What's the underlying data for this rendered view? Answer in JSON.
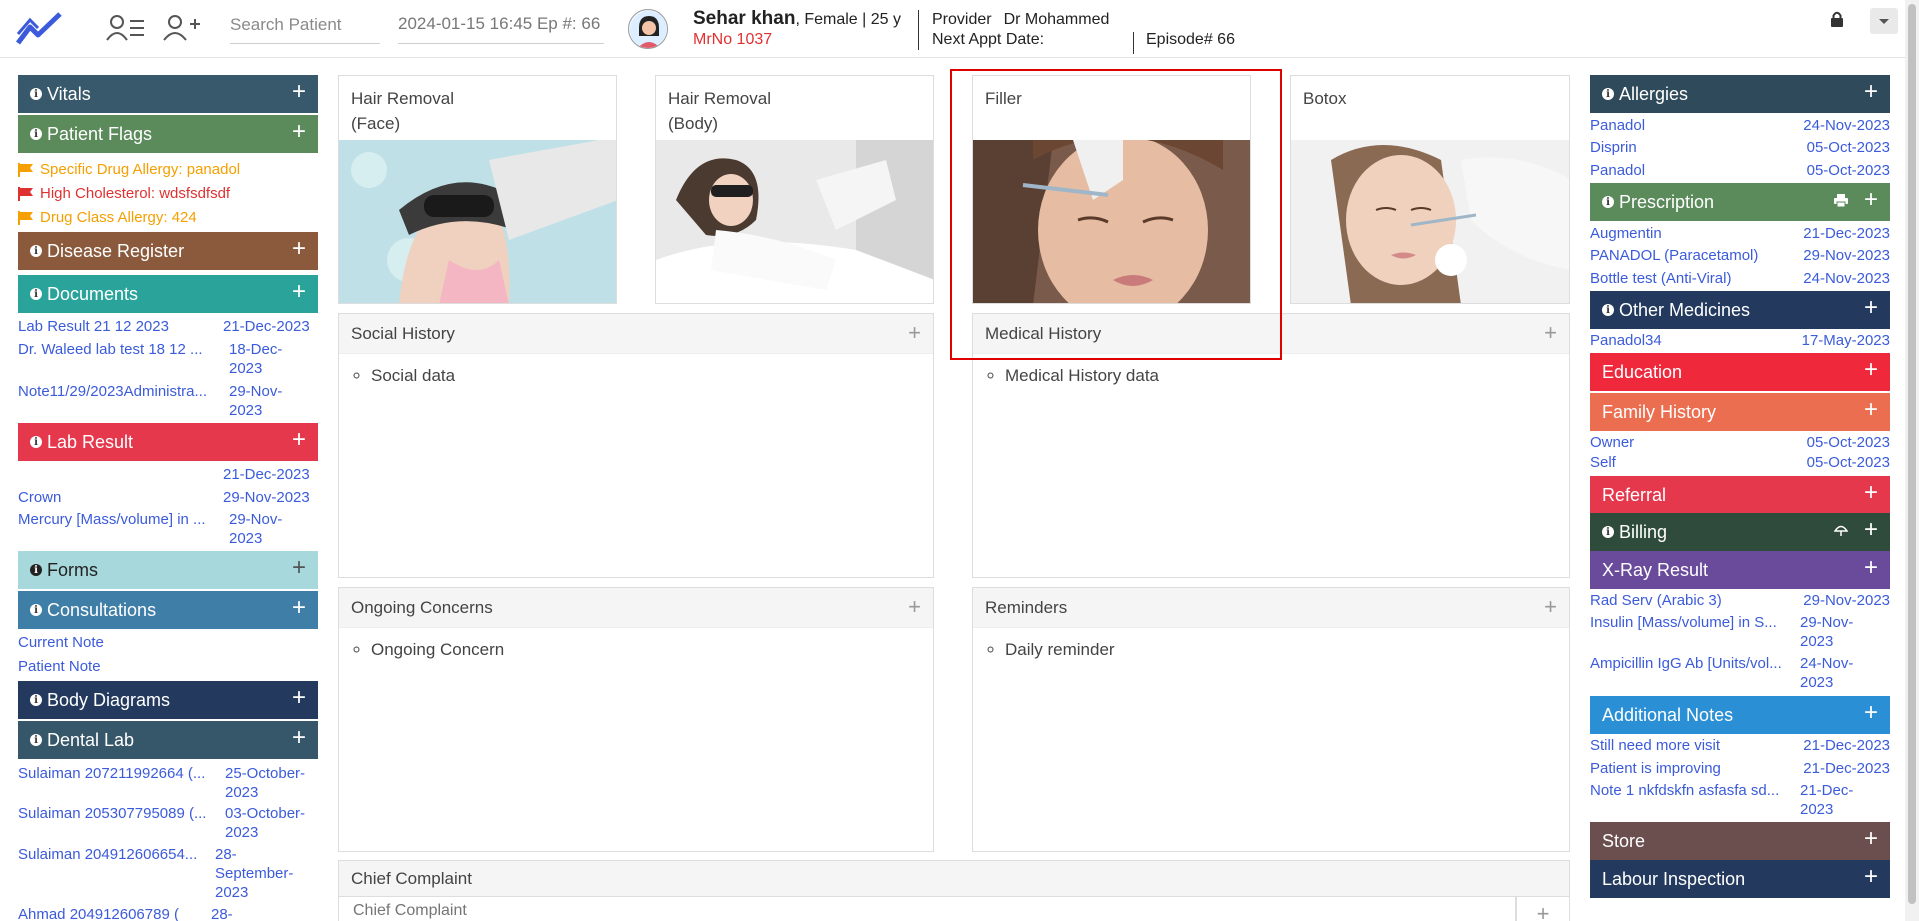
{
  "header": {
    "search_placeholder": "Search Patient",
    "episode_select": "2024-01-15 16:45 Ep #: 66",
    "patient_name": "Sehar khan",
    "patient_meta": ", Female | 25 y",
    "mrn": "MrNo 1037",
    "provider_label": "Provider",
    "provider_value": "Dr Mohammed",
    "next_appt_label": "Next Appt Date:",
    "episode_label": "Episode# 66"
  },
  "left": {
    "vitals": "Vitals",
    "patient_flags": "Patient Flags",
    "flags": [
      {
        "text": "Specific Drug Allergy: panadol",
        "color": "#f59f00"
      },
      {
        "text": "High Cholesterol: wdsfsdfsdf",
        "color": "#e03131"
      },
      {
        "text": "Drug Class Allergy: 424",
        "color": "#f59f00"
      }
    ],
    "disease_register": "Disease Register",
    "documents": "Documents",
    "documents_rows": [
      {
        "name": "Lab Result 21 12 2023",
        "date": "21-Dec-2023"
      },
      {
        "name": "Dr. Waleed lab test 18 12 ...",
        "date1": "18-Dec-",
        "date2": "2023"
      },
      {
        "name": "Note11/29/2023Administra...",
        "date1": "29-Nov-",
        "date2": "2023"
      }
    ],
    "lab_result": "Lab Result",
    "lab_rows": [
      {
        "name": "",
        "date": "21-Dec-2023"
      },
      {
        "name": "Crown",
        "date": "29-Nov-2023"
      },
      {
        "name": "Mercury [Mass/volume] in ...",
        "date1": "29-Nov-",
        "date2": "2023"
      }
    ],
    "forms": "Forms",
    "consultations": "Consultations",
    "consult_rows": [
      "Current Note",
      "Patient Note"
    ],
    "body_diagrams": "Body Diagrams",
    "dental_lab": "Dental Lab",
    "dental_rows": [
      {
        "name": "Sulaiman 207211992664 (...",
        "date1": "25-October-",
        "date2": "2023"
      },
      {
        "name": "Sulaiman 205307795089 (...",
        "date1": "03-October-",
        "date2": "2023"
      },
      {
        "name": "Sulaiman 204912606654...",
        "date1": "28-",
        "date2": "September-",
        "date3": "2023"
      },
      {
        "name": "Ahmad 204912606789 (",
        "date1": "28-"
      }
    ]
  },
  "center": {
    "cards": [
      {
        "title1": "Hair Removal",
        "title2": "(Face)"
      },
      {
        "title1": "Hair Removal",
        "title2": "(Body)"
      },
      {
        "title1": "Filler",
        "title2": ""
      },
      {
        "title1": "Botox",
        "title2": ""
      }
    ],
    "social_history": {
      "title": "Social History",
      "item": "Social data"
    },
    "medical_history": {
      "title": "Medical History",
      "item": "Medical History data"
    },
    "ongoing_concerns": {
      "title": "Ongoing Concerns",
      "item": "Ongoing Concern"
    },
    "reminders": {
      "title": "Reminders",
      "item": "Daily reminder"
    },
    "chief_complaint": {
      "title": "Chief Complaint",
      "placeholder": "Chief Complaint"
    }
  },
  "right": {
    "allergies": "Allergies",
    "allergy_rows": [
      {
        "name": "Panadol",
        "date": "24-Nov-2023"
      },
      {
        "name": "Disprin",
        "date": "05-Oct-2023"
      },
      {
        "name": "Panadol",
        "date": "05-Oct-2023"
      }
    ],
    "prescription": "Prescription",
    "prescription_rows": [
      {
        "name": "Augmentin",
        "date": "21-Dec-2023"
      },
      {
        "name": "PANADOL (Paracetamol)",
        "date": "29-Nov-2023"
      },
      {
        "name": "Bottle test (Anti-Viral)",
        "date": "24-Nov-2023"
      }
    ],
    "other_medicines": "Other Medicines",
    "other_rows": [
      {
        "name": "Panadol34",
        "date": "17-May-2023"
      }
    ],
    "education": "Education",
    "family_history": "Family History",
    "family_rows": [
      {
        "name": "Owner",
        "date": "05-Oct-2023"
      },
      {
        "name": "Self",
        "date": "05-Oct-2023"
      }
    ],
    "referral": "Referral",
    "billing": "Billing",
    "xray": "X-Ray Result",
    "xray_rows": [
      {
        "name": "Rad Serv (Arabic 3)",
        "date": "29-Nov-2023"
      },
      {
        "name": "Insulin [Mass/volume] in S...",
        "date1": "29-Nov-",
        "date2": "2023"
      },
      {
        "name": "Ampicillin IgG Ab [Units/vol...",
        "date1": "24-Nov-",
        "date2": "2023"
      }
    ],
    "additional_notes": "Additional Notes",
    "notes_rows": [
      {
        "name": "Still need more visit",
        "date": "21-Dec-2023"
      },
      {
        "name": "Patient is improving",
        "date": "21-Dec-2023"
      },
      {
        "name": "Note 1 nkfdskfn asfasfa sd...",
        "date1": "21-Dec-",
        "date2": "2023"
      }
    ],
    "store": "Store",
    "labour_inspection": "Labour Inspection"
  },
  "colors": {
    "vitals": "#37596b",
    "patient_flags": "#5b8a5b",
    "disease_register": "#8b5a3c",
    "documents": "#2aa39a",
    "lab_result": "#e6384d",
    "forms": "#a6d8dc",
    "consultations": "#3f7ea6",
    "body_diagrams": "#233a5e",
    "dental_lab": "#36576a",
    "allergies": "#2f4a5a",
    "prescription": "#5b8a5b",
    "other_medicines": "#233a5e",
    "education": "#f0283c",
    "family_history": "#ec6e50",
    "referral": "#e6384d",
    "billing": "#2f4b3b",
    "xray": "#6a4a9a",
    "additional_notes": "#2a8fd4",
    "store": "#6b4e4e",
    "labour_inspection": "#233a5e",
    "link": "#3b5bdb"
  }
}
